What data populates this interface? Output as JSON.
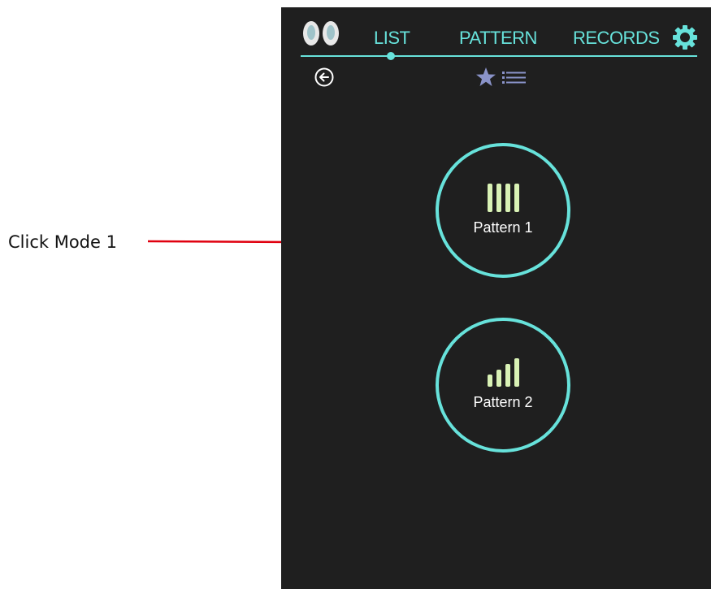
{
  "annotation": {
    "text": "Click Mode 1"
  },
  "header": {
    "tabs": [
      {
        "label": "LIST",
        "active": true
      },
      {
        "label": "PATTERN",
        "active": false
      },
      {
        "label": "RECORDS",
        "active": false
      }
    ]
  },
  "toolbar": {
    "back_icon": "arrow-left-circle",
    "favorites_icon": "star-list"
  },
  "patterns": [
    {
      "label": "Pattern 1",
      "icon": "equal-bars"
    },
    {
      "label": "Pattern 2",
      "icon": "rising-bars"
    }
  ],
  "colors": {
    "accent": "#67e2db",
    "background": "#1f1f1f",
    "bars": "#d9f2b5",
    "star": "#8a93c9",
    "pointer_line": "#e0000f"
  }
}
